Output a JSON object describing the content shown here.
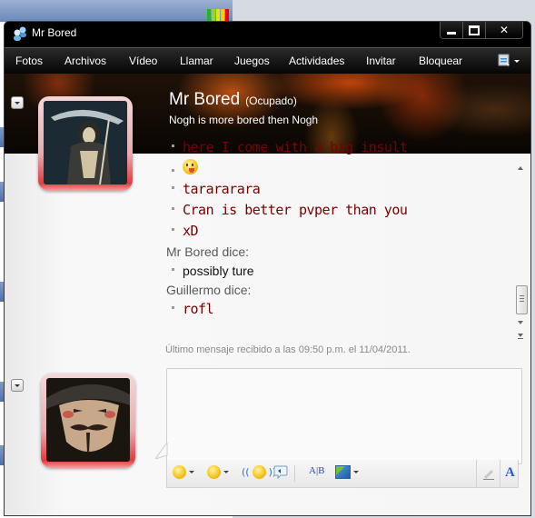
{
  "window": {
    "title": "Mr Bored",
    "controls": {
      "minimize": "–",
      "maximize": "□",
      "close": "✕"
    }
  },
  "menu": {
    "items": [
      "Fotos",
      "Archivos",
      "Vídeo",
      "Llamar",
      "Juegos",
      "Actividades",
      "Invitar",
      "Bloquear"
    ],
    "options_icon": "options-menu-icon"
  },
  "contact": {
    "name": "Mr Bored",
    "status": "(Ocupado)",
    "personal_message": "Nogh is more bored then Nogh"
  },
  "conversation": {
    "lines": [
      {
        "type": "message",
        "style": "comic",
        "text": "here I come with a big insult"
      },
      {
        "type": "emoticon",
        "style": "comic",
        "text": "",
        "icon": "tongue-out-emoticon"
      },
      {
        "type": "message",
        "style": "comic",
        "text": "tarararara"
      },
      {
        "type": "message",
        "style": "comic",
        "text": "Cran is better pvper than you"
      },
      {
        "type": "message",
        "style": "comic",
        "text": "xD"
      },
      {
        "type": "sender",
        "text": "Mr Bored dice:"
      },
      {
        "type": "message",
        "style": "plain",
        "text": "possibly ture"
      },
      {
        "type": "sender",
        "text": "Guillermo dice:"
      },
      {
        "type": "message",
        "style": "comic",
        "text": "rofl"
      }
    ],
    "last_message_info": "Último mensaje recibido a las 09:50 p.m. el 11/04/2011."
  },
  "compose": {
    "value": "",
    "toolbar": {
      "icons": [
        "emoticon-icon",
        "wink-icon",
        "nudge-icon",
        "voice-clip-icon",
        "text-style-icon",
        "background-icon",
        "handwriting-icon",
        "font-icon"
      ]
    }
  },
  "colors": {
    "comic_text": "#7a0000",
    "window_frame": "#000000",
    "avatar_glow": "#e23b3e"
  }
}
